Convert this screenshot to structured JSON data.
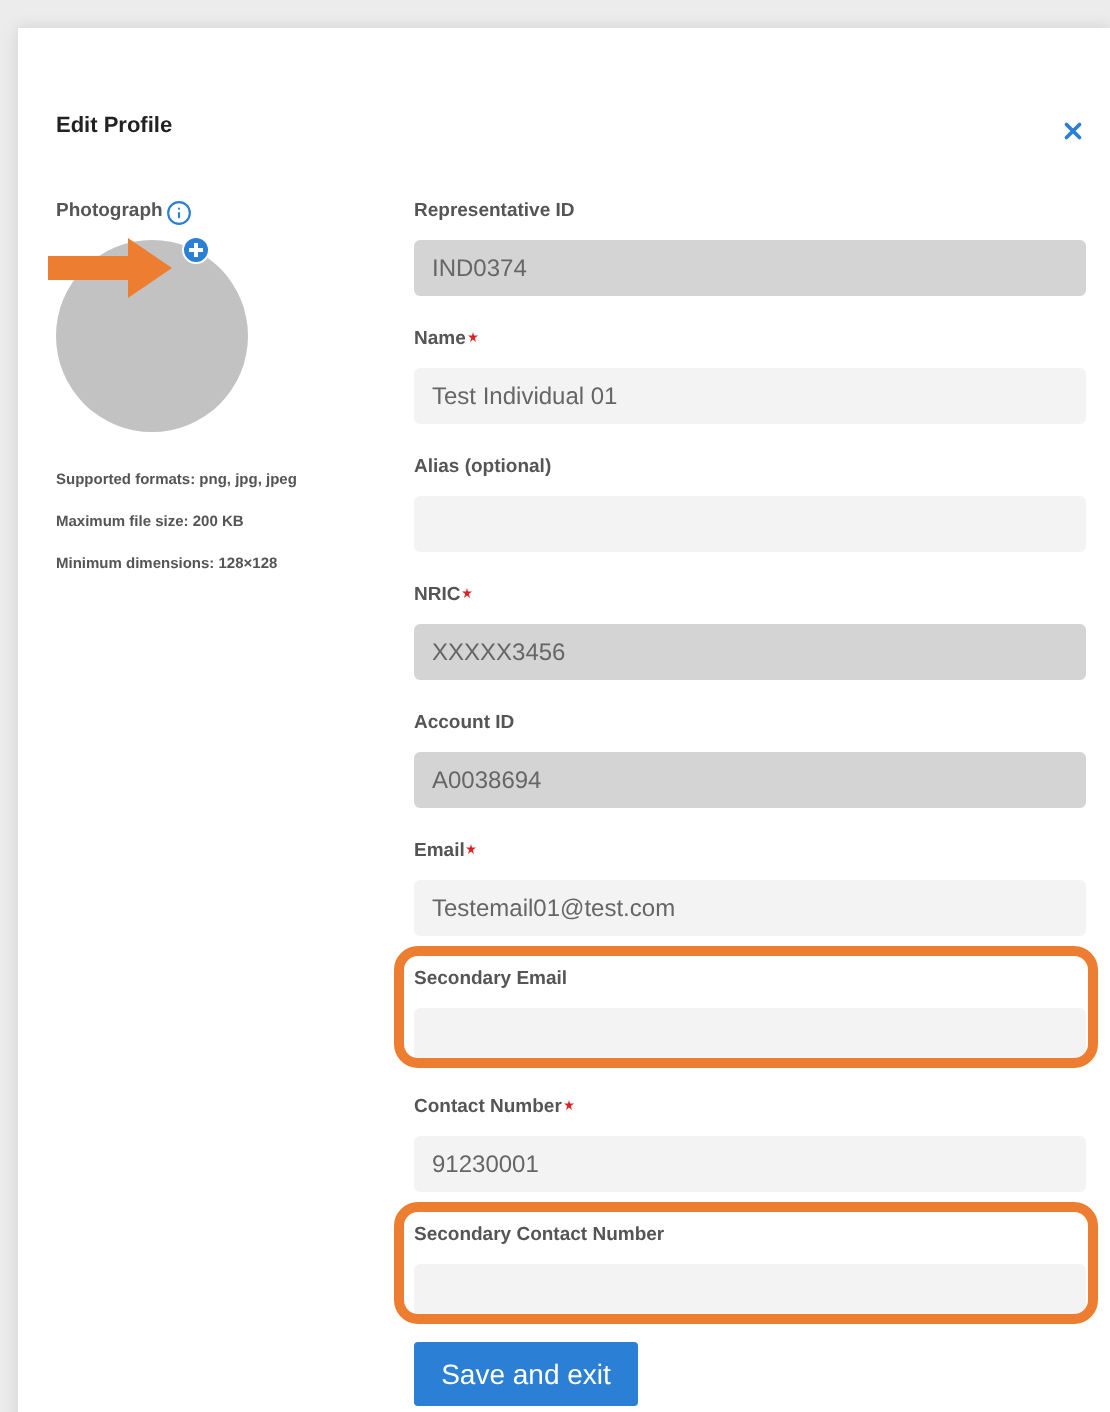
{
  "dialog": {
    "title": "Edit Profile"
  },
  "photo": {
    "label": "Photograph",
    "hints": [
      "Supported formats: png, jpg, jpeg",
      "Maximum file size: 200 KB",
      "Minimum dimensions: 128×128"
    ]
  },
  "fields": [
    {
      "label": "Representative ID",
      "value": "IND0374",
      "kind": "readonly",
      "required": false,
      "highlighted": false
    },
    {
      "label": "Name",
      "value": "Test Individual 01",
      "kind": "editable",
      "required": true,
      "highlighted": false
    },
    {
      "label": "Alias (optional)",
      "kind": "editable",
      "required": false,
      "highlighted": false
    },
    {
      "label": "NRIC",
      "value": "XXXXX3456",
      "kind": "readonly",
      "required": true,
      "highlighted": false
    },
    {
      "label": "Account ID",
      "value": "A0038694",
      "kind": "readonly",
      "required": false,
      "highlighted": false
    },
    {
      "label": "Email",
      "value": "Testemail01@test.com",
      "kind": "editable",
      "required": true,
      "highlighted": false
    },
    {
      "label": "Secondary Email",
      "kind": "editable",
      "required": false,
      "highlighted": true
    },
    {
      "label": "Contact Number",
      "value": "91230001",
      "kind": "editable",
      "required": true,
      "highlighted": false
    },
    {
      "label": "Secondary Contact Number",
      "kind": "editable",
      "required": false,
      "highlighted": true
    }
  ],
  "save_button": "Save and exit"
}
